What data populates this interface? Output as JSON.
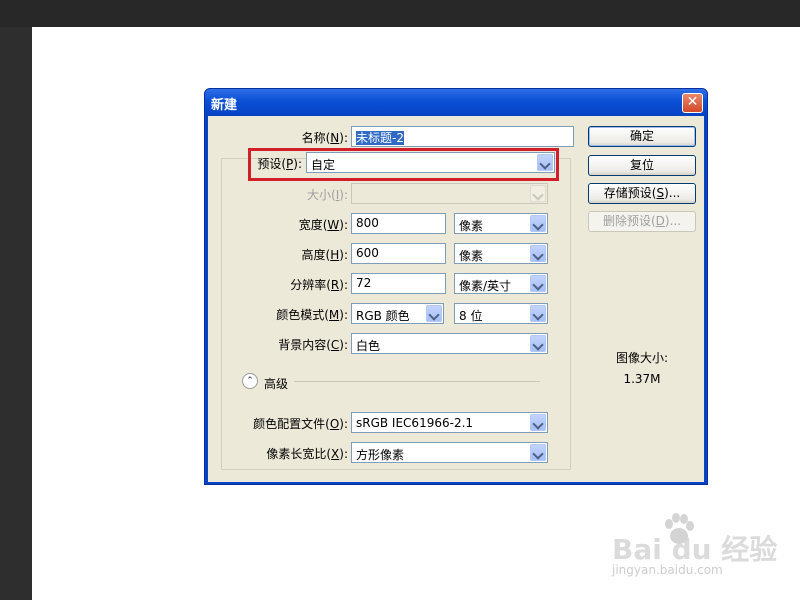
{
  "dialog": {
    "title": "新建",
    "close_glyph": "✕",
    "name": {
      "label": "名称(",
      "key": "N",
      "label_end": "):",
      "value": "未标题-2"
    },
    "preset": {
      "label": "预设(",
      "key": "P",
      "label_end": "):",
      "value": "自定"
    },
    "size": {
      "label": "大小(",
      "key": "I",
      "label_end": "):",
      "value": ""
    },
    "width": {
      "label": "宽度(",
      "key": "W",
      "label_end": "):",
      "value": "800",
      "unit": "像素"
    },
    "height": {
      "label": "高度(",
      "key": "H",
      "label_end": "):",
      "value": "600",
      "unit": "像素"
    },
    "resolution": {
      "label": "分辨率(",
      "key": "R",
      "label_end": "):",
      "value": "72",
      "unit": "像素/英寸"
    },
    "color_mode": {
      "label": "颜色模式(",
      "key": "M",
      "label_end": "):",
      "value": "RGB 颜色",
      "depth": "8 位"
    },
    "background": {
      "label": "背景内容(",
      "key": "C",
      "label_end": "):",
      "value": "白色"
    },
    "advanced": {
      "label": "高级",
      "toggle_glyph": "⌃"
    },
    "color_profile": {
      "label": "颜色配置文件(",
      "key": "O",
      "label_end": "):",
      "value": "sRGB IEC61966-2.1"
    },
    "pixel_aspect": {
      "label": "像素长宽比(",
      "key": "X",
      "label_end": "):",
      "value": "方形像素"
    },
    "buttons": {
      "ok": "确定",
      "reset": "复位",
      "save_preset": {
        "text": "存储预设(",
        "key": "S",
        "text_end": ")..."
      },
      "delete_preset": {
        "text": "删除预设(",
        "key": "D",
        "text_end": ")..."
      }
    },
    "image_size": {
      "label": "图像大小:",
      "value": "1.37M"
    }
  },
  "watermark": {
    "brand": "Bai du 经验",
    "url": "jingyan.baidu.com"
  },
  "colors": {
    "title_blue": "#0a4fd6",
    "dialog_bg": "#ece9d8",
    "highlight_red": "#d21e28"
  }
}
